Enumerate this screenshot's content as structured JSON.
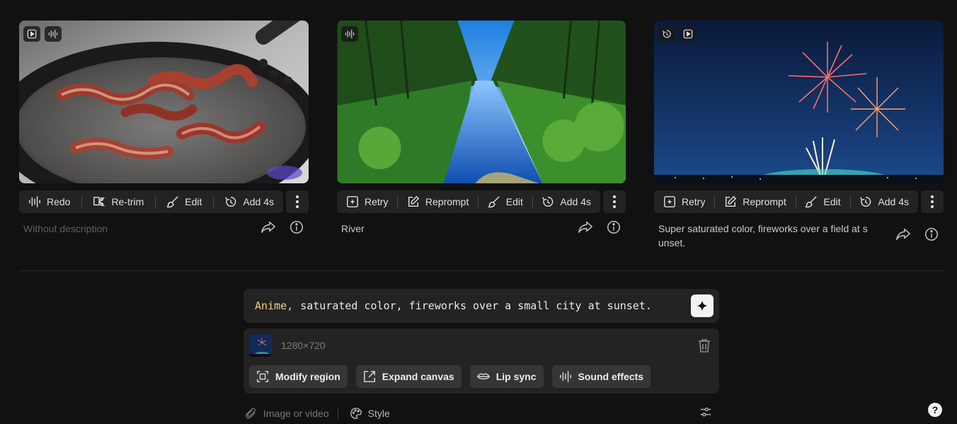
{
  "cards": [
    {
      "badges": [
        "play-icon",
        "audio-waveform-icon"
      ],
      "actions": [
        {
          "icon": "audio-waveform-icon",
          "label": "Redo"
        },
        {
          "icon": "retrim-icon",
          "label": "Re-trim"
        },
        {
          "icon": "brush-icon",
          "label": "Edit"
        },
        {
          "icon": "timer-plus-icon",
          "label": "Add 4s"
        }
      ],
      "description": "Without description",
      "muted": true
    },
    {
      "badges": [
        "audio-waveform-icon"
      ],
      "actions": [
        {
          "icon": "retry-icon",
          "label": "Retry"
        },
        {
          "icon": "pencil-square-icon",
          "label": "Reprompt"
        },
        {
          "icon": "brush-icon",
          "label": "Edit"
        },
        {
          "icon": "timer-plus-icon",
          "label": "Add 4s"
        }
      ],
      "description": "River",
      "muted": false
    },
    {
      "badges": [
        "timer-plus-icon",
        "play-icon"
      ],
      "actions": [
        {
          "icon": "retry-icon",
          "label": "Retry"
        },
        {
          "icon": "pencil-square-icon",
          "label": "Reprompt"
        },
        {
          "icon": "brush-icon",
          "label": "Edit"
        },
        {
          "icon": "timer-plus-icon",
          "label": "Add 4s"
        }
      ],
      "description_lines": [
        "Super saturated color, fireworks over a field at s",
        "unset."
      ],
      "muted": false
    }
  ],
  "prompt": {
    "keyword": "Anime,",
    "text": "saturated color, fireworks over a small city at sunset."
  },
  "attachment": {
    "size": "1280×720",
    "tools": [
      "Modify region",
      "Expand canvas",
      "Lip sync",
      "Sound effects"
    ]
  },
  "bottom_bar": {
    "image_or_video": "Image or video",
    "style": "Style"
  },
  "help_label": "?",
  "colors": {
    "background": "#111111",
    "panel": "#232323",
    "keyword": "#f1cf86"
  }
}
